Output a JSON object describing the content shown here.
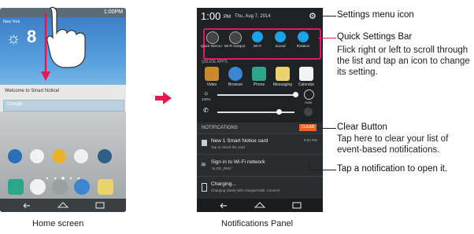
{
  "home_screen": {
    "caption": "Home screen",
    "status": {
      "time": "1:00PM"
    },
    "weather": {
      "location": "New York"
    },
    "notice_text": "Welcome to Smart Notice!",
    "search": {
      "brand": "Google"
    }
  },
  "notifications_panel": {
    "caption": "Notifications Panel",
    "status": {
      "time": "1:00",
      "ampm": "PM",
      "date": "Thu, Aug 7, 2014"
    },
    "quick_settings": [
      "Quick Memo+",
      "Wi-Fi hotspot",
      "Wi-Fi",
      "Sound",
      "Rotation"
    ],
    "qslide_header": "QSLIDE APPS",
    "qslide_apps": [
      "Video",
      "Browser",
      "Phone",
      "Messaging",
      "Calendar"
    ],
    "brightness": {
      "label": "100%",
      "auto_label": "Auto",
      "level": 1.0
    },
    "volume_level": 0.8,
    "notifications_header": "NOTIFICATIONS",
    "clear_button": "CLEAR",
    "notifications": [
      {
        "title": "New 1 Smart Notice card",
        "subtitle": "Tap to check the card",
        "time": "5:04 PM"
      },
      {
        "title": "Sign in to Wi-Fi network",
        "subtitle": "\"uLGE_REG\""
      },
      {
        "title": "Charging...",
        "subtitle": "Charging slowly with charger/USB. Connect"
      }
    ]
  },
  "callouts": {
    "settings": {
      "title": "Settings menu icon"
    },
    "quick_settings": {
      "title": "Quick Settings Bar",
      "desc": "Flick right or left to scroll through the list and tap an icon to change its setting."
    },
    "clear": {
      "title": "Clear Button",
      "desc": "Tap here to clear your list of event-based notifications."
    },
    "tap": {
      "title": "Tap a notification to open it."
    }
  },
  "colors": {
    "accent_pink": "#e0186a",
    "arrow_red": "#e8174f",
    "qs_blue": "#1aa3e8",
    "clear_orange": "#e8632a"
  }
}
